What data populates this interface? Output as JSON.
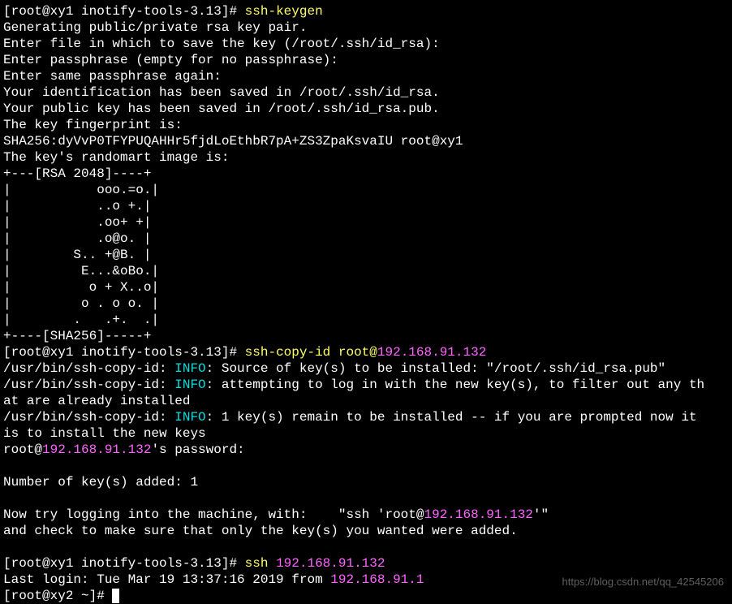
{
  "prompt1_open": "[root@xy1 inotify-tools-3.13]# ",
  "cmd1": "ssh-keygen",
  "line2": "Generating public/private rsa key pair.",
  "line3": "Enter file in which to save the key (/root/.ssh/id_rsa):",
  "line4": "Enter passphrase (empty for no passphrase):",
  "line5": "Enter same passphrase again:",
  "line6": "Your identification has been saved in /root/.ssh/id_rsa.",
  "line7": "Your public key has been saved in /root/.ssh/id_rsa.pub.",
  "line8": "The key fingerprint is:",
  "line9": "SHA256:dyVvP0TFYPUQAHHr5fjdLoEthbR7pA+ZS3ZpaKsvaIU root@xy1",
  "line10": "The key's randomart image is:",
  "art1": "+---[RSA 2048]----+",
  "art2": "|           ooo.=o.|",
  "art3": "|           ..o +.|",
  "art4": "|           .oo+ +|",
  "art5": "|           .o@o. |",
  "art6": "|        S.. +@B. |",
  "art7": "|         E...&oBo.|",
  "art8": "|          o + X..o|",
  "art9": "|         o . o o. |",
  "art10": "|        .   .+.  .|",
  "art11": "+----[SHA256]-----+",
  "prompt2": "[root@xy1 inotify-tools-3.13]# ",
  "cmd2_pre": "ssh-copy-id root@",
  "cmd2_ip": "192.168.91.132",
  "copy1_pre": "/usr/bin/ssh-copy-id: ",
  "info": "INFO",
  "copy1_post": ": Source of key(s) to be installed: \"/root/.ssh/id_rsa.pub\"",
  "copy2_post": ": attempting to log in with the new key(s), to filter out any th",
  "copy2_cont": "at are already installed",
  "copy3_post": ": 1 key(s) remain to be installed -- if you are prompted now it ",
  "copy3_cont": "is to install the new keys",
  "pass_pre": "root@",
  "pass_ip": "192.168.91.132",
  "pass_post": "'s password:",
  "added": "Number of key(s) added: 1",
  "try_pre": "Now try logging into the machine, with:    \"ssh 'root@",
  "try_ip": "192.168.91.132",
  "try_post": "'\"",
  "check": "and check to make sure that only the key(s) you wanted were added.",
  "prompt3": "[root@xy1 inotify-tools-3.13]# ",
  "cmd3_pre": "ssh ",
  "cmd3_ip": "192.168.91.132",
  "login_pre": "Last login: Tue Mar 19 13:37:16 2019 from ",
  "login_ip": "192.168.91.1",
  "prompt4": "[root@xy2 ~]# ",
  "watermark": "https://blog.csdn.net/qq_42545206"
}
